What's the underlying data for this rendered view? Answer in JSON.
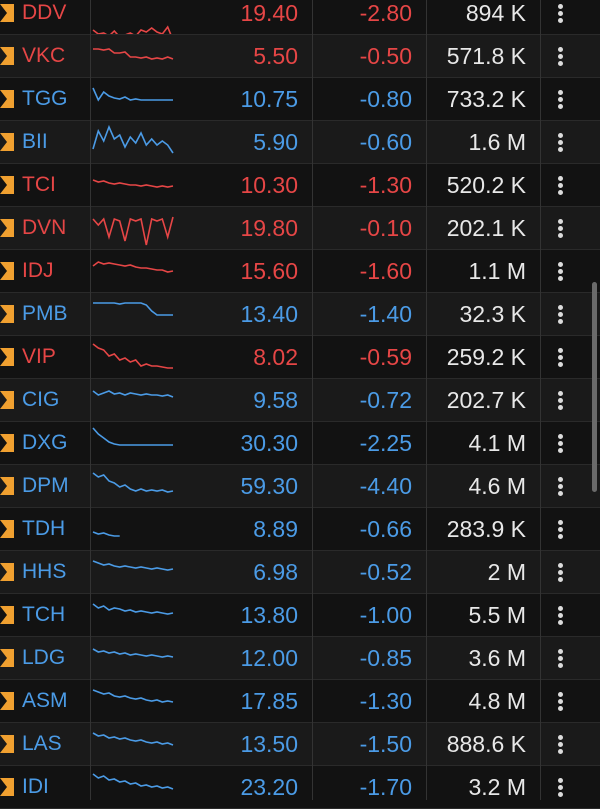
{
  "colors": {
    "down_red": "#e64646",
    "blue": "#4b9be6",
    "flag_orange": "#f0a030"
  },
  "stocks": [
    {
      "symbol": "DDV",
      "price": "19.40",
      "change": "-2.80",
      "volume": "894 K",
      "color": "red",
      "spark": [
        38,
        42,
        41,
        44,
        39,
        45,
        43,
        41,
        44,
        38,
        40,
        36,
        40,
        42,
        35,
        48
      ]
    },
    {
      "symbol": "VKC",
      "price": "5.50",
      "change": "-0.50",
      "volume": "571.8 K",
      "color": "red",
      "spark": [
        14,
        14,
        15,
        14,
        18,
        18,
        17,
        22,
        22,
        23,
        22,
        24,
        23,
        24,
        22,
        24
      ]
    },
    {
      "symbol": "TGG",
      "price": "10.75",
      "change": "-0.80",
      "volume": "733.2 K",
      "color": "blue",
      "spark": [
        10,
        22,
        14,
        18,
        20,
        21,
        19,
        22,
        21,
        22,
        22,
        22,
        22,
        22,
        22,
        22
      ]
    },
    {
      "symbol": "BII",
      "price": "5.90",
      "change": "-0.60",
      "volume": "1.6 M",
      "color": "blue",
      "spark": [
        28,
        10,
        20,
        6,
        18,
        14,
        26,
        16,
        22,
        12,
        24,
        18,
        24,
        20,
        24,
        32
      ]
    },
    {
      "symbol": "TCI",
      "price": "10.30",
      "change": "-1.30",
      "volume": "520.2 K",
      "color": "red",
      "spark": [
        16,
        18,
        17,
        19,
        20,
        19,
        20,
        21,
        21,
        22,
        21,
        22,
        23,
        22,
        23,
        22
      ]
    },
    {
      "symbol": "DVN",
      "price": "19.80",
      "change": "-0.10",
      "volume": "202.1 K",
      "color": "red",
      "spark": [
        12,
        18,
        12,
        30,
        12,
        14,
        34,
        12,
        14,
        12,
        38,
        12,
        14,
        12,
        30,
        10
      ]
    },
    {
      "symbol": "IDJ",
      "price": "15.60",
      "change": "-1.60",
      "volume": "1.1 M",
      "color": "red",
      "spark": [
        16,
        12,
        14,
        13,
        14,
        15,
        16,
        15,
        17,
        18,
        18,
        19,
        20,
        20,
        22,
        21
      ]
    },
    {
      "symbol": "PMB",
      "price": "13.40",
      "change": "-1.40",
      "volume": "32.3 K",
      "color": "blue",
      "spark": [
        10,
        10,
        10,
        10,
        10,
        11,
        10,
        10,
        10,
        10,
        12,
        18,
        22,
        22,
        22,
        22
      ]
    },
    {
      "symbol": "VIP",
      "price": "8.02",
      "change": "-0.59",
      "volume": "259.2 K",
      "color": "red",
      "spark": [
        8,
        12,
        14,
        20,
        18,
        24,
        22,
        26,
        24,
        30,
        28,
        30,
        30,
        31,
        32,
        32
      ]
    },
    {
      "symbol": "CIG",
      "price": "9.58",
      "change": "-0.72",
      "volume": "202.7 K",
      "color": "blue",
      "spark": [
        12,
        16,
        14,
        12,
        15,
        14,
        16,
        14,
        15,
        16,
        15,
        16,
        16,
        17,
        16,
        18
      ]
    },
    {
      "symbol": "DXG",
      "price": "30.30",
      "change": "-2.25",
      "volume": "4.1 M",
      "color": "blue",
      "spark": [
        6,
        12,
        16,
        20,
        22,
        23,
        23,
        23,
        23,
        23,
        23,
        23,
        23,
        23,
        23,
        23
      ]
    },
    {
      "symbol": "DPM",
      "price": "59.30",
      "change": "-4.40",
      "volume": "4.6 M",
      "color": "blue",
      "spark": [
        8,
        12,
        10,
        16,
        18,
        22,
        20,
        24,
        26,
        24,
        26,
        25,
        26,
        25,
        27,
        26
      ]
    },
    {
      "symbol": "TDH",
      "price": "8.89",
      "change": "-0.66",
      "volume": "283.9 K",
      "color": "blue",
      "spark": [
        24,
        26,
        25,
        27,
        28,
        28
      ]
    },
    {
      "symbol": "HHS",
      "price": "6.98",
      "change": "-0.52",
      "volume": "2 M",
      "color": "blue",
      "spark": [
        10,
        12,
        14,
        13,
        15,
        16,
        15,
        16,
        17,
        16,
        17,
        18,
        17,
        18,
        19,
        18
      ]
    },
    {
      "symbol": "TCH",
      "price": "13.80",
      "change": "-1.00",
      "volume": "5.5 M",
      "color": "blue",
      "spark": [
        10,
        14,
        12,
        16,
        14,
        15,
        17,
        16,
        18,
        17,
        18,
        19,
        18,
        19,
        20,
        19
      ]
    },
    {
      "symbol": "LDG",
      "price": "12.00",
      "change": "-0.85",
      "volume": "3.6 M",
      "color": "blue",
      "spark": [
        12,
        15,
        14,
        16,
        15,
        17,
        16,
        18,
        17,
        18,
        19,
        18,
        19,
        20,
        19,
        20
      ]
    },
    {
      "symbol": "ASM",
      "price": "17.85",
      "change": "-1.30",
      "volume": "4.8 M",
      "color": "blue",
      "spark": [
        10,
        12,
        14,
        13,
        16,
        17,
        16,
        18,
        19,
        18,
        20,
        21,
        20,
        22,
        21,
        22
      ]
    },
    {
      "symbol": "LAS",
      "price": "13.50",
      "change": "-1.50",
      "volume": "888.6 K",
      "color": "blue",
      "spark": [
        10,
        13,
        12,
        15,
        14,
        16,
        15,
        17,
        18,
        17,
        19,
        20,
        19,
        21,
        20,
        22
      ]
    },
    {
      "symbol": "IDI",
      "price": "23.20",
      "change": "-1.70",
      "volume": "3.2 M",
      "color": "blue",
      "spark": [
        8,
        12,
        10,
        14,
        13,
        16,
        15,
        18,
        17,
        20,
        19,
        21,
        20,
        22,
        21,
        23
      ]
    }
  ]
}
